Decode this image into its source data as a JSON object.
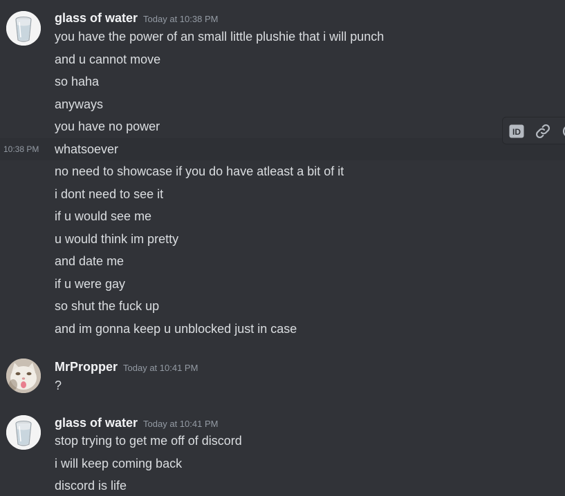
{
  "colors": {
    "background": "#313338",
    "text": "#dbdee1",
    "username": "#f2f3f5",
    "timestamp": "#949ba4",
    "hover": "#2e3035"
  },
  "groups": [
    {
      "author": "glass of water",
      "avatar_icon": "glass-of-water-avatar",
      "timestamp": "Today at 10:38 PM",
      "lines": [
        "you have the power of an small little plushie that i will punch",
        "and u cannot move",
        "so haha",
        "anyways",
        "you have no power",
        "whatsoever",
        "no need to showcase if you do have atleast a bit of it",
        "i dont need to see it",
        "if u would see me",
        "u would think im pretty",
        "and date me",
        "if u were gay",
        "so shut the fuck up",
        "and im gonna keep u unblocked just in case"
      ]
    },
    {
      "author": "MrPropper",
      "avatar_icon": "cat-avatar",
      "timestamp": "Today at 10:41 PM",
      "lines": [
        "?"
      ]
    },
    {
      "author": "glass of water",
      "avatar_icon": "glass-of-water-avatar",
      "timestamp": "Today at 10:41 PM",
      "lines": [
        "stop trying to get me off of discord",
        "i will keep coming back",
        "discord is life"
      ]
    }
  ],
  "hovered_message": {
    "time": "10:38 PM"
  },
  "toolbar": {
    "icons": [
      "id-icon",
      "link-icon",
      "more-icon"
    ]
  }
}
